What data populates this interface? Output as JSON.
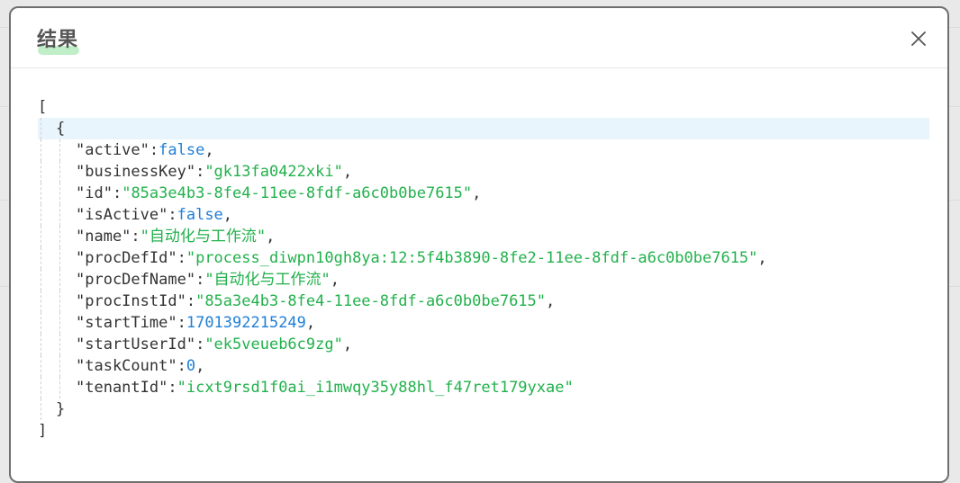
{
  "dialog": {
    "title": "结果"
  },
  "json": {
    "open_bracket": "[",
    "open_brace": "{",
    "close_brace": "}",
    "close_bracket": "]",
    "fields": [
      {
        "key": "\"active\"",
        "value": "false",
        "kind": "bool",
        "comma": ","
      },
      {
        "key": "\"businessKey\"",
        "value": "\"gk13fa0422xki\"",
        "kind": "string",
        "comma": ","
      },
      {
        "key": "\"id\"",
        "value": "\"85a3e4b3-8fe4-11ee-8fdf-a6c0b0be7615\"",
        "kind": "string",
        "comma": ","
      },
      {
        "key": "\"isActive\"",
        "value": "false",
        "kind": "bool",
        "comma": ","
      },
      {
        "key": "\"name\"",
        "value": "\"自动化与工作流\"",
        "kind": "string",
        "comma": ","
      },
      {
        "key": "\"procDefId\"",
        "value": "\"process_diwpn10gh8ya:12:5f4b3890-8fe2-11ee-8fdf-a6c0b0be7615\"",
        "kind": "string",
        "comma": ","
      },
      {
        "key": "\"procDefName\"",
        "value": "\"自动化与工作流\"",
        "kind": "string",
        "comma": ","
      },
      {
        "key": "\"procInstId\"",
        "value": "\"85a3e4b3-8fe4-11ee-8fdf-a6c0b0be7615\"",
        "kind": "string",
        "comma": ","
      },
      {
        "key": "\"startTime\"",
        "value": "1701392215249",
        "kind": "number",
        "comma": ","
      },
      {
        "key": "\"startUserId\"",
        "value": "\"ek5veueb6c9zg\"",
        "kind": "string",
        "comma": ","
      },
      {
        "key": "\"taskCount\"",
        "value": "0",
        "kind": "number",
        "comma": ","
      },
      {
        "key": "\"tenantId\"",
        "value": "\"icxt9rsd1f0ai_i1mwqy35y88hl_f47ret179yxae\"",
        "kind": "string",
        "comma": ""
      }
    ]
  },
  "colors": {
    "string": "#22b14c",
    "number": "#1f7fd6",
    "boolean": "#1f7fd6",
    "highlight": "#e9f5fd"
  },
  "icons": {
    "close": "close-icon"
  }
}
